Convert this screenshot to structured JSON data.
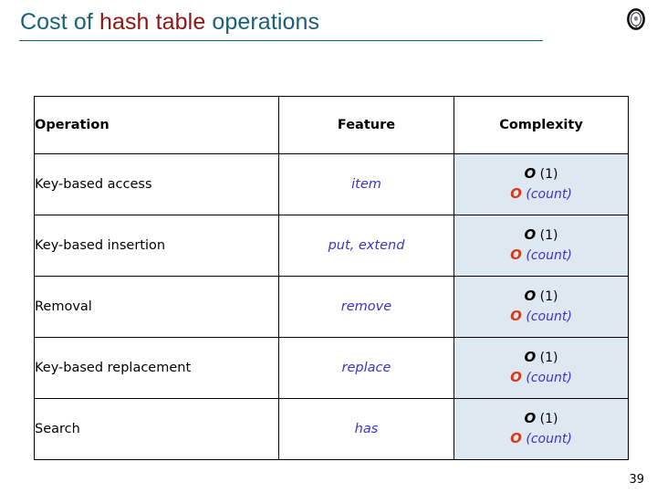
{
  "slide": {
    "title_parts": {
      "part1": "Cost of ",
      "part2": "hash table ",
      "part3": "operations"
    },
    "page_number": "39",
    "colors": {
      "title_teal": "#1b6079",
      "title_dark_red": "#8f1616",
      "rule": "#1b6079",
      "highlight_cell_bg": "#dee8f1",
      "feature_blue": "#3b34c8",
      "complexity_o_red": "#d83a17",
      "complexity_o_black": "#000000",
      "table_border": "#000000"
    },
    "icons": {
      "disc": "disc-icon"
    }
  },
  "table": {
    "headers": {
      "operation": "Operation",
      "feature": "Feature",
      "complexity": "Complexity"
    },
    "rows": [
      {
        "operation": "Key-based access",
        "feature": "item",
        "complexity_line1_o": "O",
        "complexity_line1_arg": " (1)",
        "complexity_line2_o": "O",
        "complexity_line2_arg": " (count)"
      },
      {
        "operation": "Key-based insertion",
        "feature": "put, extend",
        "complexity_line1_o": "O",
        "complexity_line1_arg": " (1)",
        "complexity_line2_o": "O",
        "complexity_line2_arg": " (count)"
      },
      {
        "operation": "Removal",
        "feature": "remove",
        "complexity_line1_o": "O",
        "complexity_line1_arg": " (1)",
        "complexity_line2_o": "O",
        "complexity_line2_arg": " (count)"
      },
      {
        "operation": "Key-based replacement",
        "feature": "replace",
        "complexity_line1_o": "O",
        "complexity_line1_arg": " (1)",
        "complexity_line2_o": "O",
        "complexity_line2_arg": " (count)"
      },
      {
        "operation": "Search",
        "feature": "has",
        "complexity_line1_o": "O",
        "complexity_line1_arg": " (1)",
        "complexity_line2_o": "O",
        "complexity_line2_arg": " (count)"
      }
    ]
  }
}
